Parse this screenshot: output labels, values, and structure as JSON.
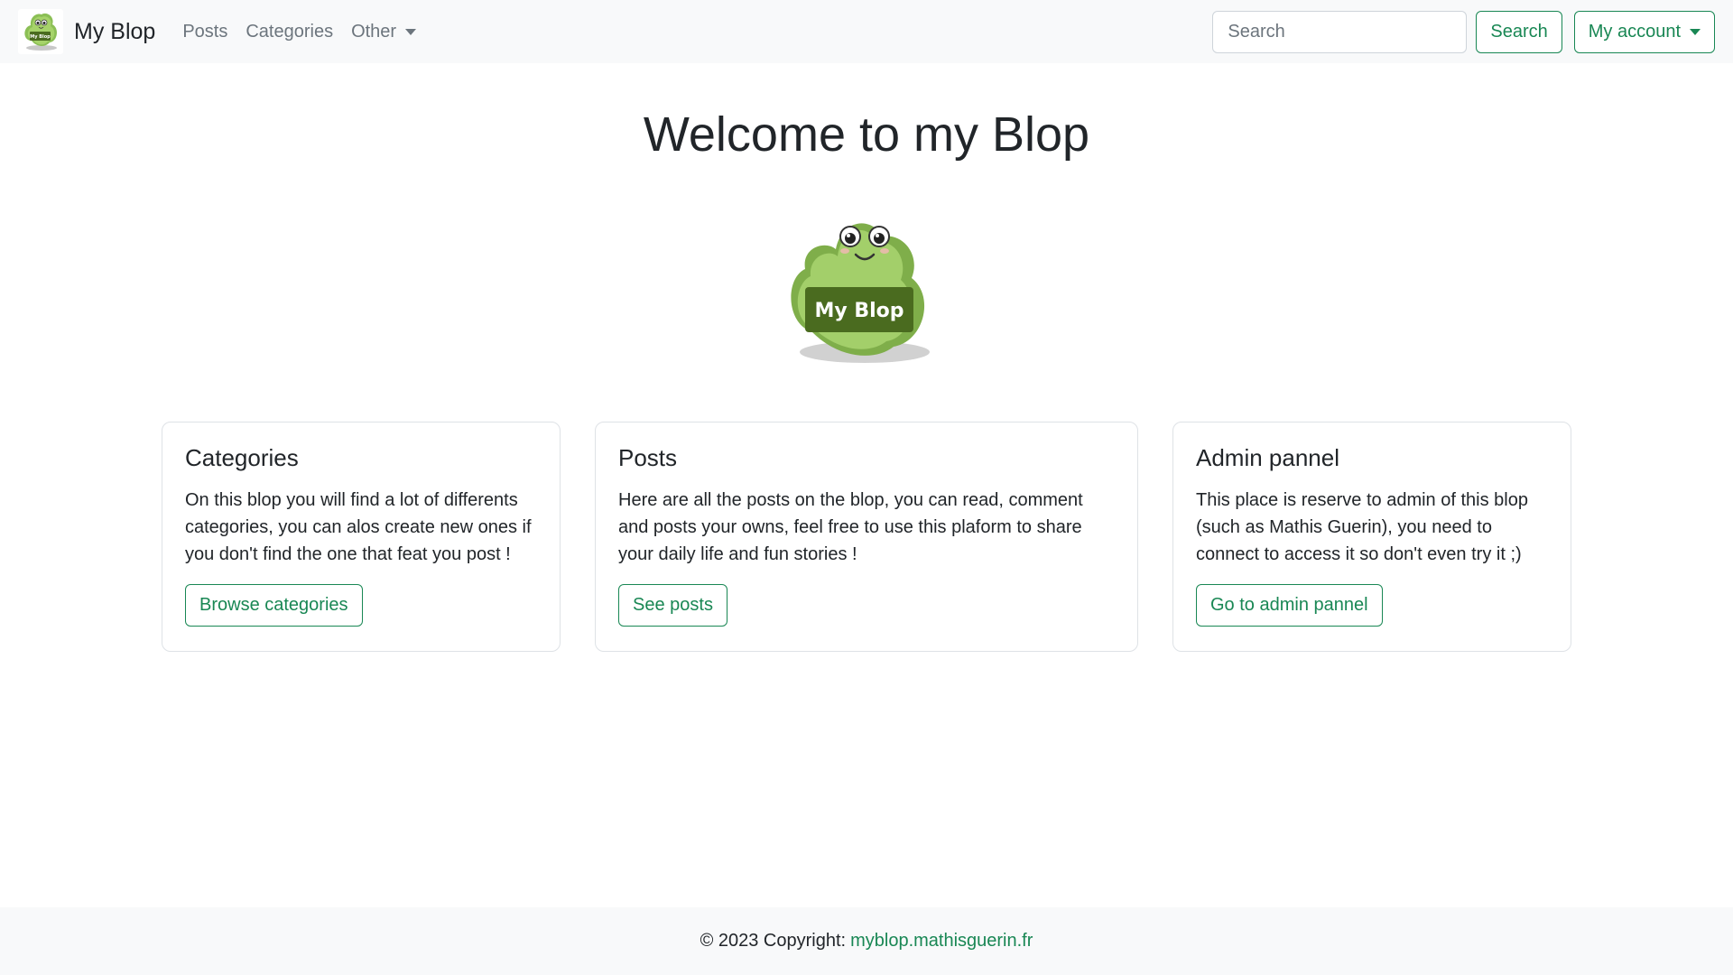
{
  "navbar": {
    "brand_name": "My Blop",
    "links": [
      {
        "label": "Posts"
      },
      {
        "label": "Categories"
      },
      {
        "label": "Other"
      }
    ],
    "search_placeholder": "Search",
    "search_button": "Search",
    "account_button": "My account"
  },
  "hero": {
    "title": "Welcome to my Blop",
    "logo_text": "My Blop"
  },
  "cards": [
    {
      "title": "Categories",
      "text": "On this blop you will find a lot of differents categories, you can alos create new ones if you don't find the one that feat you post !",
      "button": "Browse categories"
    },
    {
      "title": "Posts",
      "text": "Here are all the posts on the blop, you can read, comment and posts your owns, feel free to use this plaform to share your daily life and fun stories !",
      "button": "See posts"
    },
    {
      "title": "Admin pannel",
      "text": "This place is reserve to admin of this blop (such as Mathis Guerin), you need to connect to access it so don't even try it ;)",
      "button": "Go to admin pannel"
    }
  ],
  "footer": {
    "copyright": "© 2023 Copyright:",
    "link_text": "myblop.mathisguerin.fr"
  },
  "colors": {
    "accent": "#198754",
    "navbar_bg": "#f8f9fa",
    "mascot_green": "#9ccc65",
    "mascot_dark": "#4a6b1f"
  }
}
